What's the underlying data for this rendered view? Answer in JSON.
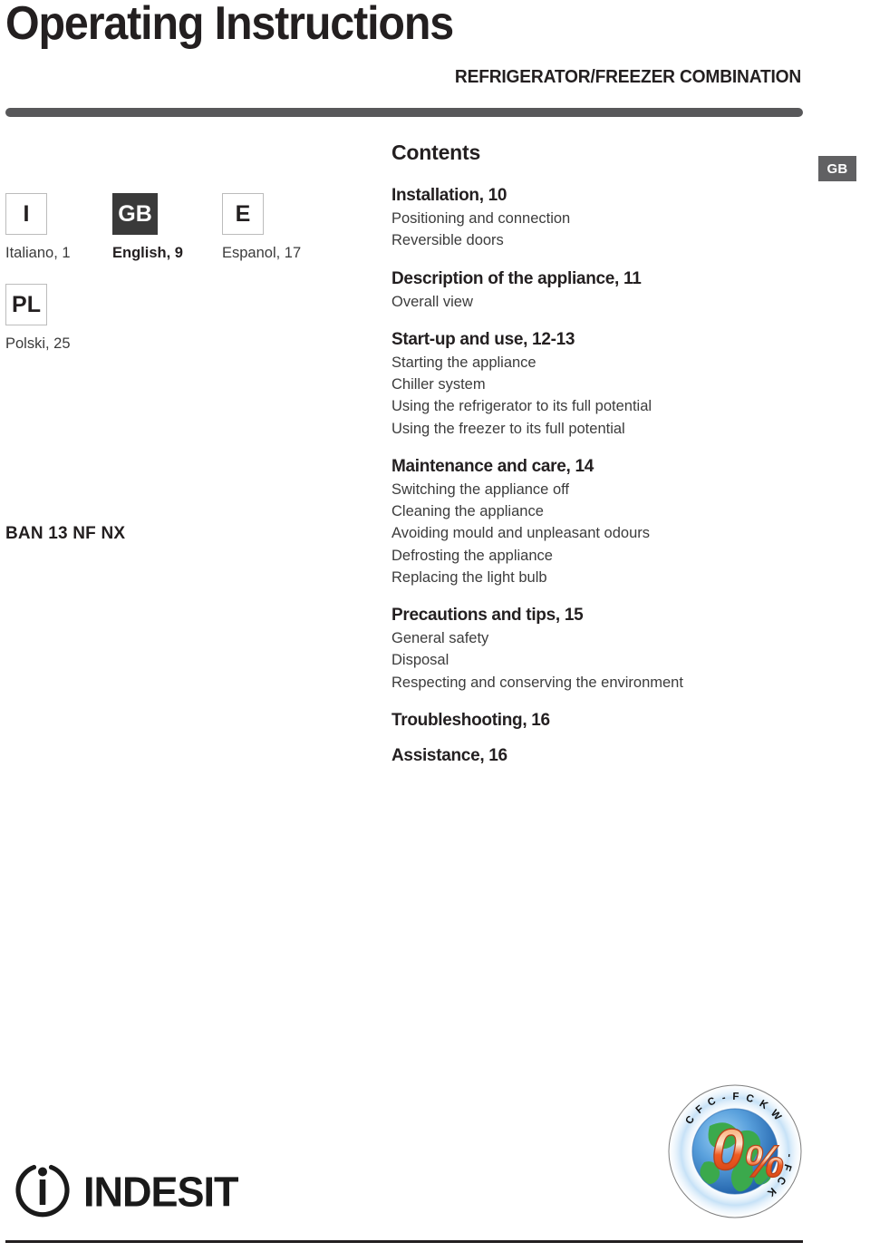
{
  "header": {
    "title": "Operating Instructions",
    "subtitle": "REFRIGERATOR/FREEZER COMBINATION",
    "rule_color": "#58585a"
  },
  "languages": {
    "items": [
      {
        "code": "I",
        "label": "Italiano, 1",
        "active": false
      },
      {
        "code": "GB",
        "label": "English, 9",
        "active": true
      },
      {
        "code": "E",
        "label": "Espanol, 17",
        "active": false
      },
      {
        "code": "PL",
        "label": "Polski, 25",
        "active": false
      }
    ],
    "active_bg": "#3a3a3a"
  },
  "model": {
    "name": "BAN 13 NF NX"
  },
  "corner_badge": {
    "label": "GB",
    "bg": "#616163"
  },
  "contents": {
    "heading": "Contents",
    "groups": [
      {
        "title": "Installation, 10",
        "items": [
          "Positioning and connection",
          "Reversible doors"
        ]
      },
      {
        "title": "Description of the appliance, 11",
        "items": [
          "Overall view"
        ]
      },
      {
        "title": "Start-up and use, 12-13",
        "items": [
          "Starting the appliance",
          "Chiller system",
          "Using the refrigerator to its full potential",
          "Using the freezer to its full potential"
        ]
      },
      {
        "title": "Maintenance and care, 14",
        "items": [
          "Switching the appliance off",
          "Cleaning the appliance",
          "Avoiding mould and unpleasant odours",
          "Defrosting the appliance",
          "Replacing the light bulb"
        ]
      },
      {
        "title": "Precautions and tips, 15",
        "items": [
          "General safety",
          "Disposal",
          "Respecting and conserving the environment"
        ]
      },
      {
        "title": "Troubleshooting, 16",
        "items": []
      },
      {
        "title": "Assistance, 16",
        "items": []
      }
    ]
  },
  "brand": {
    "wordmark": "INDESIT",
    "mark_name": "indesit-circle-i-icon"
  },
  "cfc_logo": {
    "ring_text": "CFC - FCKW - FCK",
    "ring_letters": [
      "C",
      "F",
      "C",
      "-",
      "F",
      "C",
      "K",
      "W",
      "-",
      "F",
      "C",
      "K"
    ],
    "center_text": "0%",
    "center_color": "#ef5b22",
    "globe_land_color": "#3ba94c",
    "globe_sea_color": "#4a8fd4"
  }
}
